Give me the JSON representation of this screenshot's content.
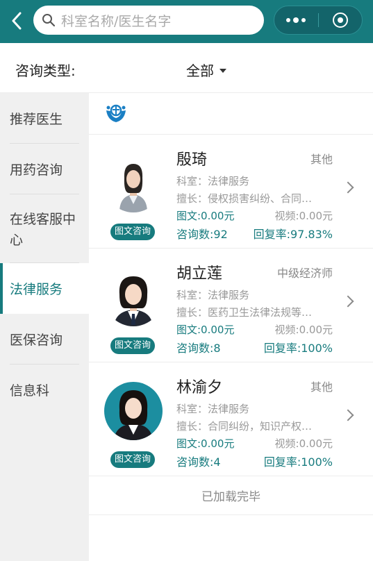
{
  "header": {
    "search_placeholder": "科室名称/医生名字"
  },
  "filter": {
    "label": "咨询类型:",
    "selected": "全部"
  },
  "sidebar": {
    "items": [
      {
        "label": "推荐医生"
      },
      {
        "label": "用药咨询"
      },
      {
        "label": "在线客服中心"
      },
      {
        "label": "法律服务"
      },
      {
        "label": "医保咨询"
      },
      {
        "label": "信息科"
      }
    ],
    "active": "法律服务"
  },
  "list": {
    "doctors": [
      {
        "name": "殷琦",
        "title": "其他",
        "dept": "科室：法律服务",
        "skill": "擅长：侵权损害纠纷、合同…",
        "text_price": "图文:0.00元",
        "video_price": "视频:0.00元",
        "count": "咨询数:92",
        "rate": "回复率:97.83%",
        "button": "图文咨询"
      },
      {
        "name": "胡立莲",
        "title": "中级经济师",
        "dept": "科室：法律服务",
        "skill": "擅长：医药卫生法律法规等…",
        "text_price": "图文:0.00元",
        "video_price": "视频:0.00元",
        "count": "咨询数:8",
        "rate": "回复率:100%",
        "button": "图文咨询"
      },
      {
        "name": "林渝夕",
        "title": "其他",
        "dept": "科室：法律服务",
        "skill": "擅长：合同纠纷，知识产权…",
        "text_price": "图文:0.00元",
        "video_price": "视频:0.00元",
        "count": "咨询数:4",
        "rate": "回复率:100%",
        "button": "图文咨询"
      }
    ],
    "footer": "已加载完毕"
  },
  "colors": {
    "primary": "#177b7e",
    "sidebar_bg": "#f0f0f0"
  }
}
